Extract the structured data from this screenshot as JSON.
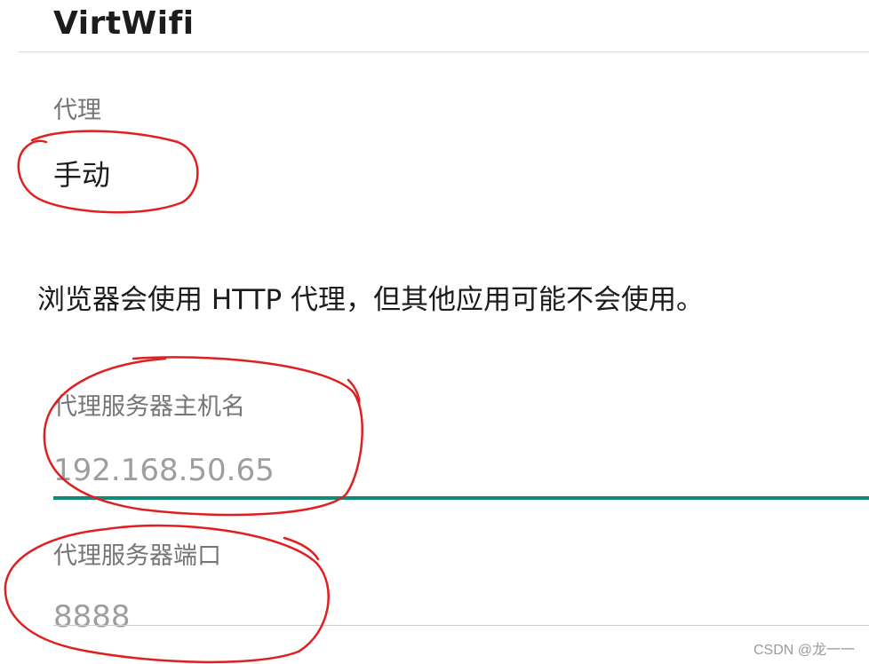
{
  "header": {
    "title": "VirtWifi"
  },
  "proxy": {
    "label": "代理",
    "value": "手动"
  },
  "notice": {
    "text": "浏览器会使用 HTTP 代理，但其他应用可能不会使用。"
  },
  "host": {
    "label": "代理服务器主机名",
    "value": "192.168.50.65"
  },
  "port": {
    "label": "代理服务器端口",
    "value": "8888"
  },
  "watermark": {
    "text": "CSDN @龙一一"
  },
  "colors": {
    "accent_underline": "#128a78",
    "annotation_red": "#e02020"
  }
}
